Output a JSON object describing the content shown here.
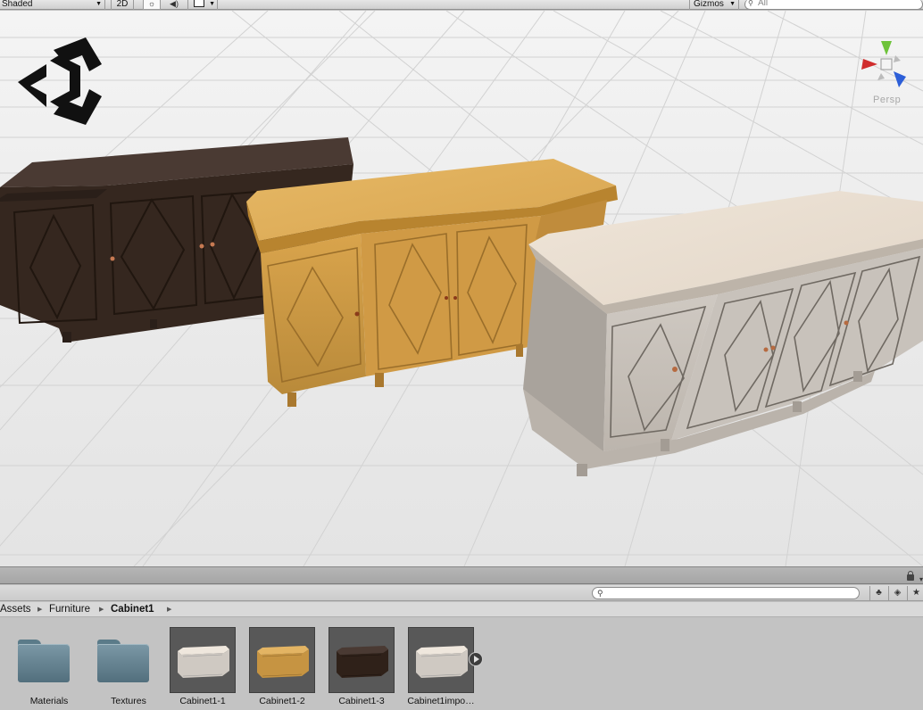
{
  "scene_toolbar": {
    "shading_mode": "Shaded",
    "mode_2d": "2D",
    "lighting_icon": "sun-icon",
    "audio_icon": "speaker-icon",
    "effects_icon": "image-icon",
    "gizmos_label": "Gizmos",
    "search_placeholder": "All"
  },
  "viewport": {
    "projection_label": "Persp",
    "logo": "unity-logo",
    "gizmo_icon": "orientation-gizmo-icon",
    "objects": [
      {
        "name": "dark-cabinet",
        "finish_color": "#3a2c25"
      },
      {
        "name": "oak-cabinet",
        "finish_color": "#c9983f"
      },
      {
        "name": "white-cabinet",
        "finish_color": "#d8d2ca"
      }
    ]
  },
  "project": {
    "search_placeholder": "",
    "breadcrumb": [
      "Assets",
      "Furniture",
      "Cabinet1"
    ],
    "assets": [
      {
        "label": "Materials",
        "type": "folder"
      },
      {
        "label": "Textures",
        "type": "folder"
      },
      {
        "label": "Cabinet1-1",
        "type": "prefab",
        "color": "#d8d2ca"
      },
      {
        "label": "Cabinet1-2",
        "type": "prefab",
        "color": "#c9983f"
      },
      {
        "label": "Cabinet1-3",
        "type": "prefab",
        "color": "#3a2c25"
      },
      {
        "label": "Cabinet1impo…",
        "type": "model",
        "color": "#d8d2ca"
      }
    ]
  }
}
